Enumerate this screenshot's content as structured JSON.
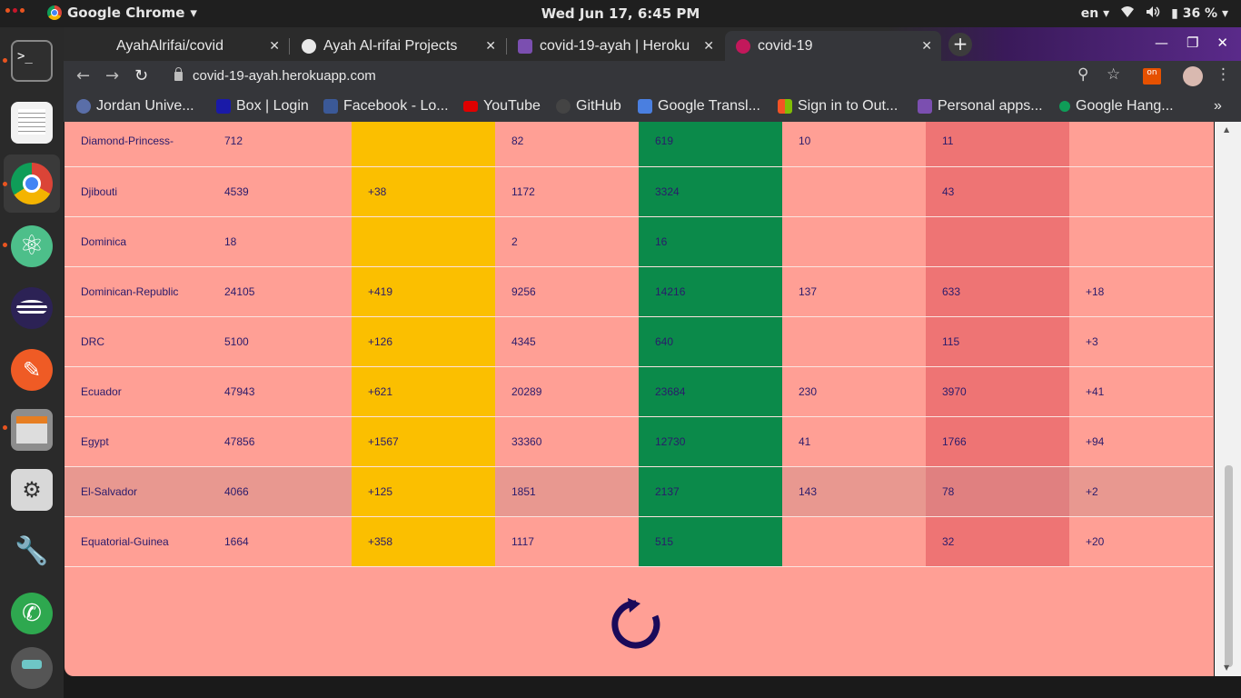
{
  "system": {
    "app_name": "Google Chrome",
    "clock": "Wed Jun 17,  6:45 PM",
    "lang": "en",
    "battery": "36 %"
  },
  "tabs": [
    {
      "title": "AyahAlrifai/covid",
      "icon": "github-icon"
    },
    {
      "title": "Ayah Al-rifai Projects",
      "icon": "globe-icon"
    },
    {
      "title": "covid-19-ayah | Heroku",
      "icon": "heroku-icon"
    },
    {
      "title": "covid-19",
      "icon": "virus-icon"
    }
  ],
  "url": "covid-19-ayah.herokuapp.com",
  "bookmarks": [
    {
      "label": "Jordan Unive...",
      "icon": "ju-icon",
      "color": "#5a6ea8"
    },
    {
      "label": "Box | Login",
      "icon": "box-icon",
      "color": "#1a1aa8"
    },
    {
      "label": "Facebook - Lo...",
      "icon": "facebook-icon",
      "color": "#3b5998"
    },
    {
      "label": "YouTube",
      "icon": "youtube-icon",
      "color": "#e00000"
    },
    {
      "label": "GitHub",
      "icon": "github-icon",
      "color": "#444444"
    },
    {
      "label": "Google Transl...",
      "icon": "translate-icon",
      "color": "#4a7fe0"
    },
    {
      "label": "Sign in to Out...",
      "icon": "microsoft-icon",
      "color": "#f35325"
    },
    {
      "label": "Personal apps...",
      "icon": "heroku-icon",
      "color": "#7b4fb0"
    },
    {
      "label": "Google Hang...",
      "icon": "hangouts-icon",
      "color": "#0f9d58"
    }
  ],
  "table": {
    "rows": [
      [
        "Diamond-Princess-",
        "712",
        "",
        "82",
        "619",
        "10",
        "11",
        ""
      ],
      [
        "Djibouti",
        "4539",
        "+38",
        "1172",
        "3324",
        "",
        "43",
        ""
      ],
      [
        "Dominica",
        "18",
        "",
        "2",
        "16",
        "",
        "",
        ""
      ],
      [
        "Dominican-Republic",
        "24105",
        "+419",
        "9256",
        "14216",
        "137",
        "633",
        "+18"
      ],
      [
        "DRC",
        "5100",
        "+126",
        "4345",
        "640",
        "",
        "115",
        "+3"
      ],
      [
        "Ecuador",
        "47943",
        "+621",
        "20289",
        "23684",
        "230",
        "3970",
        "+41"
      ],
      [
        "Egypt",
        "47856",
        "+1567",
        "33360",
        "12730",
        "41",
        "1766",
        "+94"
      ],
      [
        "El-Salvador",
        "4066",
        "+125",
        "1851",
        "2137",
        "143",
        "78",
        "+2"
      ],
      [
        "Equatorial-Guinea",
        "1664",
        "+358",
        "1117",
        "515",
        "",
        "32",
        "+20"
      ]
    ],
    "hover_row": 7
  },
  "colors": {
    "page_bg": "#ff9f95",
    "new_cases_col": "#fbbf00",
    "recovered_col": "#0b8a4a",
    "deaths_col": "#ee7474",
    "text": "#2a1b6b"
  },
  "refresh_icon": "refresh-icon"
}
